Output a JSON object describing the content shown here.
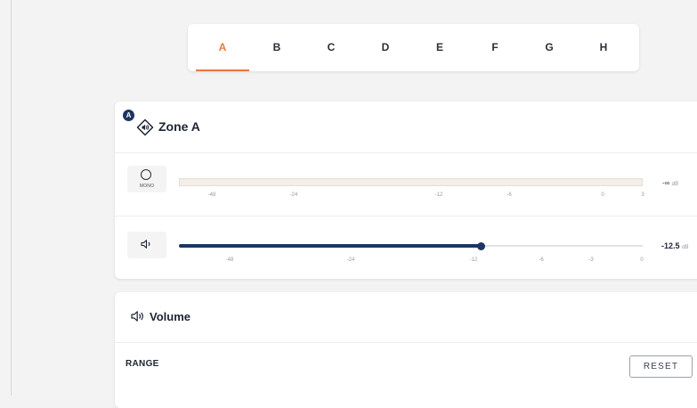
{
  "tabs": [
    "A",
    "B",
    "C",
    "D",
    "E",
    "F",
    "G",
    "H"
  ],
  "active_tab": "A",
  "zone": {
    "badge": "A",
    "title": "Zone A",
    "mono_label": "MONO",
    "meter": {
      "ticks": [
        "-48",
        "-24",
        "-12",
        "-6",
        "0",
        "3"
      ],
      "value": "-∞",
      "unit": "dB"
    },
    "gain": {
      "ticks": [
        "-48",
        "-24",
        "-12",
        "-6",
        "-3",
        "0"
      ],
      "value": "-12.5",
      "unit": "dB",
      "level_fraction": 0.65
    }
  },
  "volume": {
    "title": "Volume",
    "range_label": "RANGE",
    "reset_label": "RESET"
  },
  "colors": {
    "accent": "#e8773e",
    "primary": "#1e3561"
  }
}
